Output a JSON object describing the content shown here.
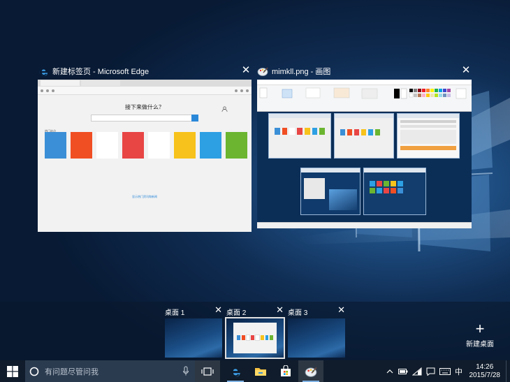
{
  "windows": [
    {
      "title": "新建标签页 - Microsoft Edge",
      "icon": "edge-icon",
      "close": "✕"
    },
    {
      "title": "mimkll.png - 画图",
      "icon": "paint-icon",
      "close": "✕"
    }
  ],
  "edge_page": {
    "heading": "接下来做什么？",
    "sites_label": "热门站点",
    "link_text": "显示热门资讯和新闻",
    "tile_colors": [
      "#3b8fd6",
      "#f04e23",
      "#ffffff",
      "#e84545",
      "#ffffff",
      "#f7c21b",
      "#2d9fe3",
      "#6bb530"
    ]
  },
  "desktops": [
    {
      "label": "桌面 1",
      "close": "✕"
    },
    {
      "label": "桌面 2",
      "close": "✕",
      "active": true
    },
    {
      "label": "桌面 3",
      "close": "✕"
    }
  ],
  "new_desktop": {
    "plus": "+",
    "label": "新建桌面"
  },
  "taskbar": {
    "search_placeholder": "有问题尽管问我",
    "apps": [
      "edge-icon",
      "file-explorer-icon",
      "store-icon",
      "paint-icon"
    ]
  },
  "tray": {
    "ime": "中",
    "time": "14:26",
    "date": "2015/7/28"
  },
  "colors": {
    "accent": "#2b88d8",
    "taskbar": "#101c2b",
    "search_box": "#2b3b4f"
  }
}
